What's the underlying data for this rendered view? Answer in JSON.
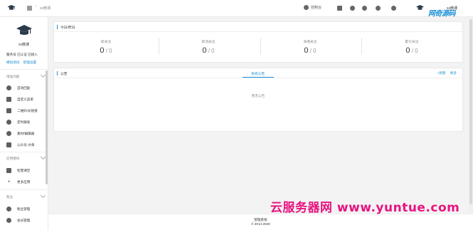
{
  "breadcrumb": {
    "current": "xx微课"
  },
  "topbar": {
    "console_label": "控制台",
    "user_name": "xx微课"
  },
  "watermark": {
    "top": "网奇源码",
    "bottom": "云服务器网 www.yuntue.com"
  },
  "sidebar": {
    "account_name": "xx微课",
    "status": "服务号 已认证 已接入",
    "links": [
      "模拟测试",
      "管理设置"
    ],
    "groups": [
      {
        "label": "增强功能",
        "items": [
          {
            "label": "自动回复",
            "icon": "reply-icon"
          },
          {
            "label": "自定义菜单",
            "icon": "menu-icon"
          },
          {
            "label": "二维码/长链接",
            "icon": "qrcode-icon"
          },
          {
            "label": "定时群发",
            "icon": "clock-icon"
          },
          {
            "label": "素材/编辑器",
            "icon": "compass-icon"
          },
          {
            "label": "公众号-文章",
            "icon": "article-icon"
          }
        ]
      },
      {
        "label": "应用模块",
        "items": [
          {
            "label": "智慧课堂",
            "icon": "classroom-icon"
          },
          {
            "label": "更多应用",
            "icon": "plus-icon"
          }
        ]
      },
      {
        "label": "粉丝",
        "items": [
          {
            "label": "粉丝管理",
            "icon": "heart-icon"
          },
          {
            "label": "会员管理",
            "icon": "member-icon"
          }
        ]
      }
    ]
  },
  "today_card": {
    "title": "今日/昨日",
    "stats": [
      {
        "label": "新关注",
        "today": "0",
        "yesterday": "0"
      },
      {
        "label": "取消关注",
        "today": "0",
        "yesterday": "0"
      },
      {
        "label": "净增关注",
        "today": "0",
        "yesterday": "0"
      },
      {
        "label": "累计关注",
        "today": "0",
        "yesterday": "0"
      }
    ]
  },
  "notice_card": {
    "title": "公告",
    "tab": "系统公告",
    "actions": [
      "+新建",
      "更多"
    ],
    "empty_text": "暂无公告"
  },
  "footer": {
    "line1": "管理系统",
    "line2": "© 2014-2020"
  },
  "colors": {
    "accent": "#1a8fd6",
    "watermark_pink": "#e8147f"
  }
}
